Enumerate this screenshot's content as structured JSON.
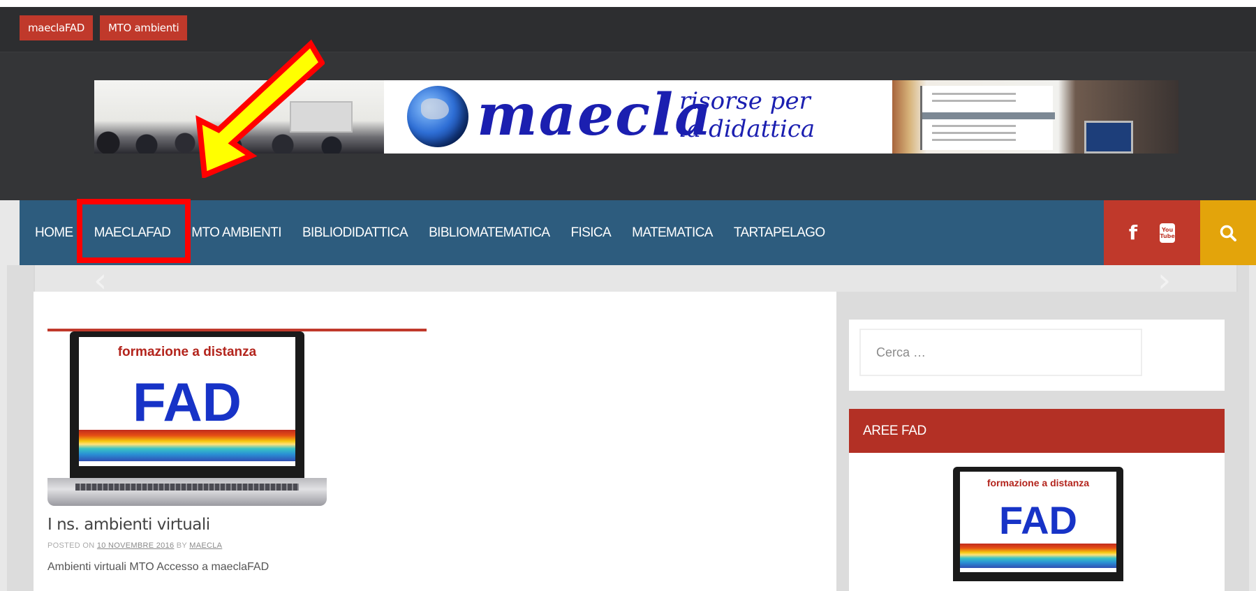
{
  "topbar": {
    "links": [
      {
        "label": "maeclaFAD"
      },
      {
        "label": "MTO ambienti"
      }
    ]
  },
  "banner": {
    "title": "maecla",
    "subtitle_line1": "risorse per",
    "subtitle_line2": "la didattica"
  },
  "nav": {
    "items": [
      {
        "label": "HOME"
      },
      {
        "label": "MAECLAFAD"
      },
      {
        "label": "MTO AMBIENTI"
      },
      {
        "label": "BIBLIODIDATTICA"
      },
      {
        "label": "BIBLIOMATEMATICA"
      },
      {
        "label": "FISICA"
      },
      {
        "label": "MATEMATICA"
      },
      {
        "label": "TARTAPELAGO"
      }
    ],
    "social": {
      "facebook": "f",
      "youtube_top": "You",
      "youtube_bottom": "Tube"
    }
  },
  "post": {
    "thumb_top": "formazione a distanza",
    "thumb_big": "FAD",
    "title": "I ns. ambienti virtuali",
    "meta_posted": "POSTED ON",
    "meta_date": "10 NOVEMBRE 2016",
    "meta_by": "BY",
    "meta_author": "MAECLA",
    "excerpt": "Ambienti virtuali MTO Accesso a maeclaFAD"
  },
  "sidebar": {
    "search_placeholder": "Cerca …",
    "widget_title": "AREE FAD",
    "widget_thumb_top": "formazione a distanza",
    "widget_thumb_big": "FAD"
  },
  "colors": {
    "accent_red": "#c0392b",
    "nav_blue": "#2d5c7e",
    "search_yellow": "#e3a40b",
    "annotation_red": "#ff0000",
    "annotation_yellow": "#ffff00"
  },
  "icons": {
    "search": "search-icon",
    "facebook": "facebook-icon",
    "youtube": "youtube-icon",
    "slider_prev": "chevron-left-icon",
    "slider_next": "chevron-right-icon",
    "annotation_arrow": "arrow-icon"
  }
}
